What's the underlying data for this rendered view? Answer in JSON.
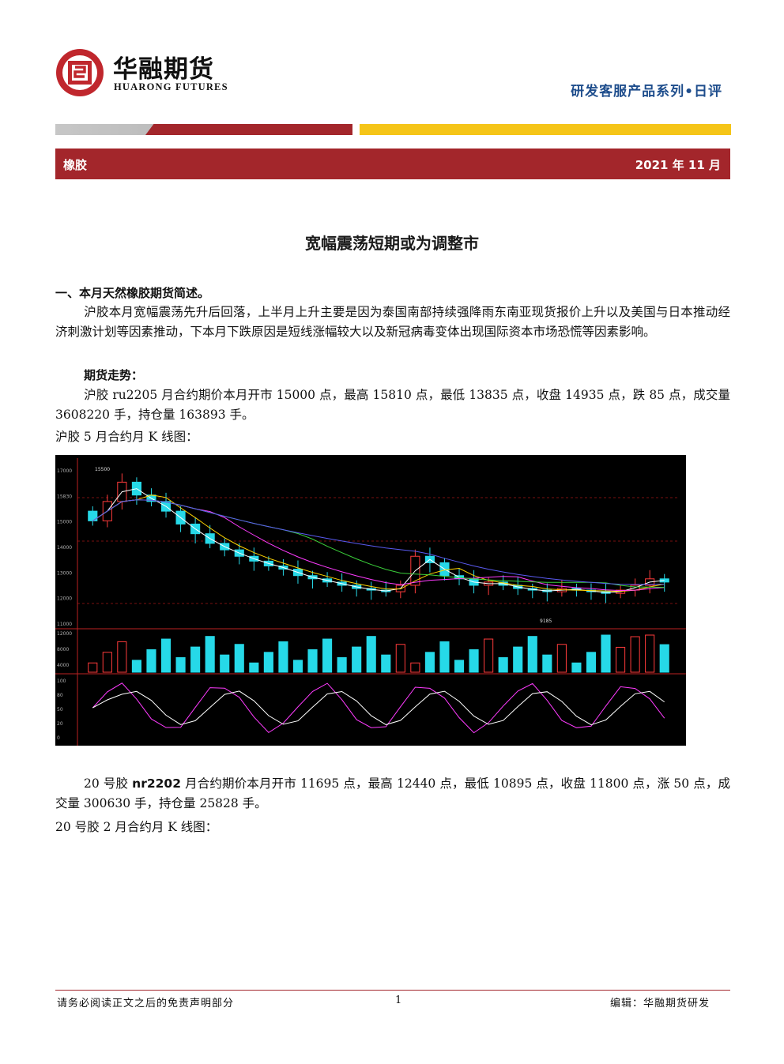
{
  "header": {
    "logo_cn": "华融期货",
    "logo_en": "HUARONG FUTURES",
    "series": "研发客服产品系列•日评"
  },
  "banner": {
    "category": "橡胶",
    "date": "2021 年 11 月"
  },
  "title": "宽幅震荡短期或为调整市",
  "section1": {
    "heading": "一、本月天然橡胶期货简述。",
    "summary": "沪胶本月宽幅震荡先升后回落，上半月上升主要是因为泰国南部持续强降雨东南亚现货报价上升以及美国与日本推动经济刺激计划等因素推动，下本月下跌原因是短线涨幅较大以及新冠病毒变体出现国际资本市场恐慌等因素影响。",
    "trend_label": "期货走势：",
    "ru_text": "沪胶 ru2205 月合约期价本月开市 15000 点，最高 15810 点，最低 13835 点，收盘 14935 点，跌 85 点，成交量 3608220 手，持仓量 163893 手。",
    "ru_caption": "沪胶 5 月合约月 K 线图：",
    "nr_text_pre": "20 号胶 ",
    "nr_code": "nr2202",
    "nr_text_post": " 月合约期价本月开市 11695 点，最高 12440 点，最低 10895 点，收盘 11800 点，涨 50 点，成交量 300630 手，持仓量 25828 手。",
    "nr_caption": "20 号胶 2 月合约月 K 线图："
  },
  "chart_data": {
    "type": "candlestick",
    "title": "",
    "price_labels": [
      "17000",
      "15830",
      "15000",
      "14000",
      "13000",
      "12000",
      "11000"
    ],
    "high_label": "15500",
    "low_label": "9185",
    "volume_labels": [
      "12000",
      "8000",
      "4000"
    ],
    "oscillator_labels": [
      "100",
      "80",
      "50",
      "20",
      "0"
    ],
    "colors": {
      "up": "#ff3b3b",
      "down": "#26d9e8",
      "ma5": "#ffffff",
      "ma10": "#ffd400",
      "ma20": "#ff3bff",
      "ma60": "#3bd13b",
      "ma120": "#5a5af0"
    },
    "closes": [
      14300,
      14900,
      15500,
      15100,
      14900,
      14600,
      14200,
      13900,
      13600,
      13400,
      13200,
      13050,
      12900,
      12800,
      12600,
      12500,
      12400,
      12300,
      12200,
      12150,
      12100,
      12300,
      13200,
      13000,
      12600,
      12500,
      12300,
      12400,
      12300,
      12200,
      12150,
      12100,
      12200,
      12150,
      12100,
      12050,
      12150,
      12300,
      12500,
      12400
    ]
  },
  "footer": {
    "disclaimer": "请务必阅读正文之后的免责声明部分",
    "page": "1",
    "editor": "编辑：华融期货研发"
  }
}
